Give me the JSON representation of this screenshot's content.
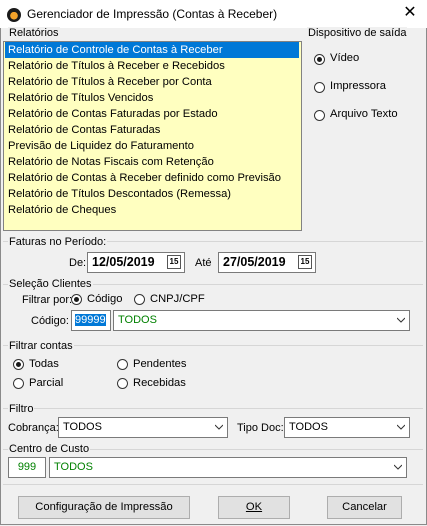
{
  "window": {
    "title": "Gerenciador de Impressão (Contas à Receber)",
    "close_glyph": "✕"
  },
  "reports": {
    "label": "Relatórios",
    "items": [
      "Relatório de Controle de Contas à Receber",
      "Relatório de Títulos à Receber e Recebidos",
      "Relatório de Títulos à Receber por Conta",
      "Relatório de Títulos Vencidos",
      "Relatório de Contas Faturadas por Estado",
      "Relatório de Contas Faturadas",
      "Previsão de Liquidez do Faturamento",
      "Relatório de Notas Fiscais com Retenção",
      "Relatório de Contas à Receber definido como Previsão",
      "Relatório de Títulos Descontados (Remessa)",
      "Relatório de Cheques"
    ],
    "selected_index": 0
  },
  "output": {
    "label": "Dispositivo de saída",
    "options": [
      "Vídeo",
      "Impressora",
      "Arquivo Texto"
    ],
    "selected": "Vídeo"
  },
  "period": {
    "label": "Faturas no Período:",
    "from_label": "De:",
    "from_value": "12/05/2019",
    "to_label": "Até",
    "to_value": "27/05/2019",
    "calendar_glyph": "15"
  },
  "clients": {
    "label": "Seleção Clientes",
    "filter_label": "Filtrar por:",
    "options": [
      "Código",
      "CNPJ/CPF"
    ],
    "selected": "Código",
    "code_label": "Código:",
    "code_value": "99999",
    "name_value": "TODOS"
  },
  "accounts": {
    "label": "Filtrar contas",
    "options": [
      "Todas",
      "Pendentes",
      "Parcial",
      "Recebidas"
    ],
    "selected": "Todas"
  },
  "filter": {
    "label": "Filtro",
    "cobranca_label": "Cobrança:",
    "cobranca_value": "TODOS",
    "tipodoc_label": "Tipo Doc:",
    "tipodoc_value": "TODOS"
  },
  "cost_center": {
    "label": "Centro de Custo",
    "code_value": "999",
    "name_value": "TODOS"
  },
  "buttons": {
    "config": "Configuração de Impressão",
    "ok": "OK",
    "cancel": "Cancelar"
  },
  "colors": {
    "selection": "#0078d7",
    "list_bg": "#ffffc0",
    "code_text": "#008000"
  }
}
